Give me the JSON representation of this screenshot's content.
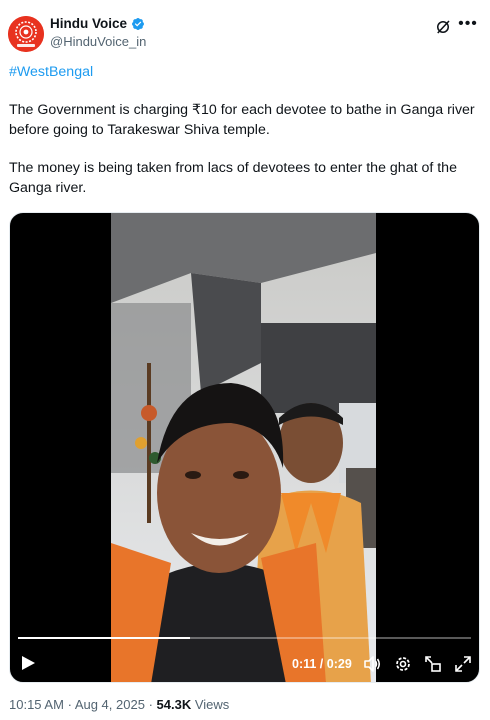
{
  "author": {
    "display_name": "Hindu Voice",
    "handle": "@HinduVoice_in"
  },
  "tweet": {
    "hashtag": "#WestBengal",
    "paragraph_1": "The Government is charging ₹10 for each devotee to bathe in Ganga river before going to Tarakeswar Shiva temple.",
    "paragraph_2": "The money is being taken from lacs of devotees to enter the ghat of the Ganga river."
  },
  "video": {
    "current_time": "0:11",
    "duration": "0:29",
    "time_display": "0:11 / 0:29",
    "progress_fraction": 0.379
  },
  "meta": {
    "time": "10:15 AM",
    "separator": "·",
    "date": "Aug 4, 2025",
    "views_count": "54.3K",
    "views_label": "Views"
  },
  "icons": {
    "verified": "verified-badge-icon",
    "grok": "grok-icon",
    "more": "more-icon",
    "play": "play-icon",
    "volume": "volume-icon",
    "settings": "settings-icon",
    "minimize": "minimize-icon",
    "fullscreen": "fullscreen-icon"
  },
  "colors": {
    "accent": "#1d9bf0",
    "avatar_bg": "#e8321f",
    "text": "#0f1419",
    "secondary": "#536471"
  }
}
